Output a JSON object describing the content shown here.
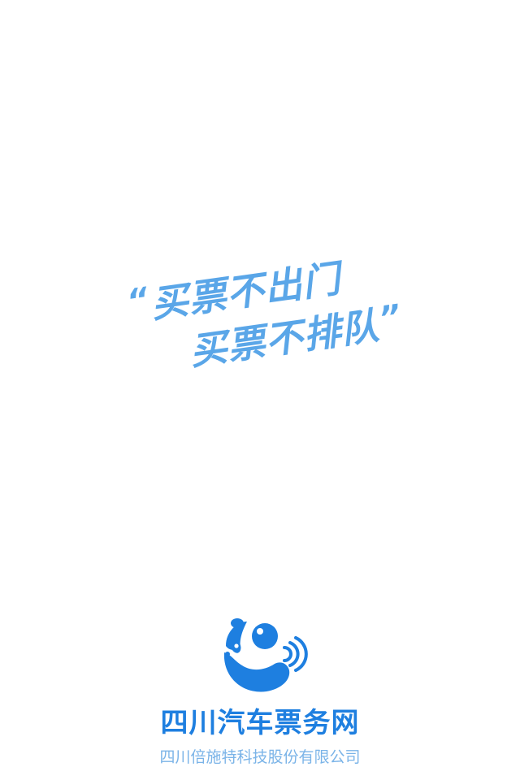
{
  "slogan": {
    "line1": "买票不出门",
    "line2": "买票不排队",
    "quote_open": "“",
    "quote_close": "”"
  },
  "brand": {
    "name": "四川汽车票务网",
    "company": "四川倍施特科技股份有限公司",
    "logo_icon": "panda-signal-logo-icon"
  },
  "colors": {
    "background": "#ffffff",
    "slogan": "#5aa6e8",
    "brand_primary": "#1e7fe0",
    "company_text": "#7bb4e8"
  }
}
